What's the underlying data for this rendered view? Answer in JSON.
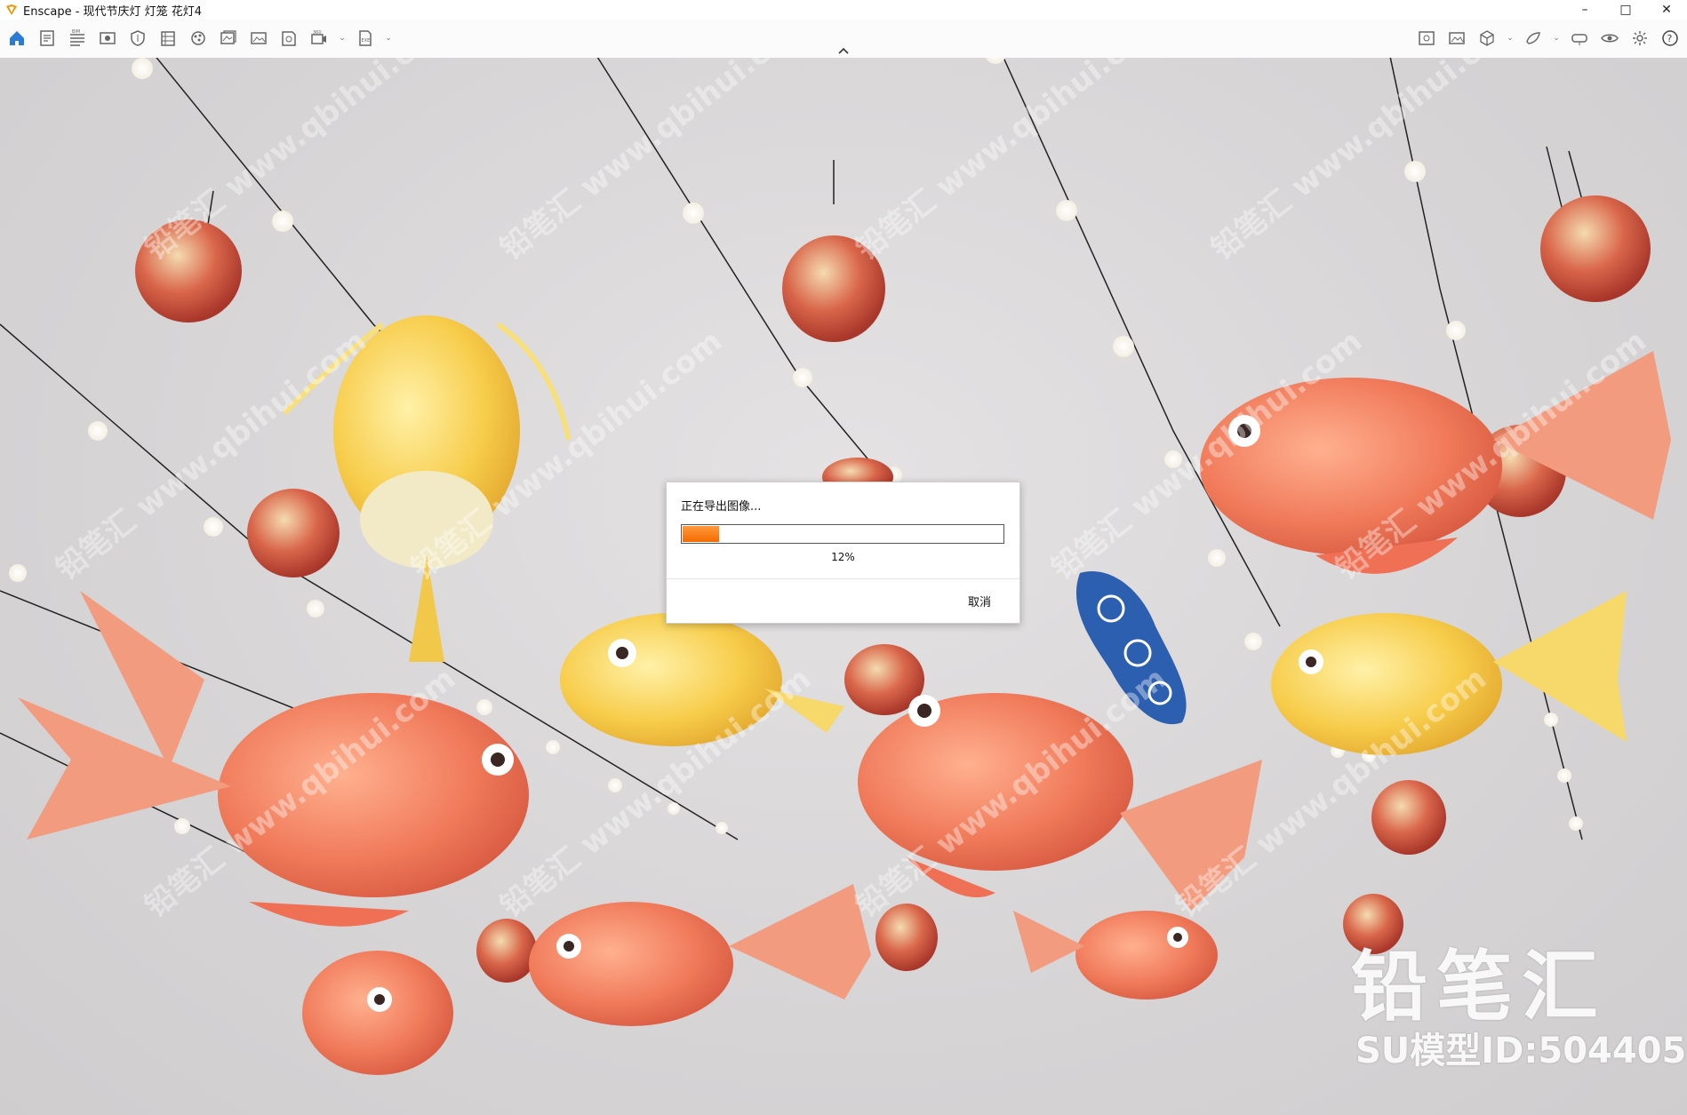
{
  "window": {
    "title": "Enscape - 现代节庆灯 灯笼 花灯4",
    "controls": {
      "minimize": "–",
      "maximize": "□",
      "close": "✕"
    }
  },
  "toolbar": {
    "left_icons": [
      "home-icon",
      "document-icon",
      "bim-list-icon",
      "eye-view-icon",
      "safe-frame-icon",
      "building-icon",
      "material-sphere-icon",
      "batch-render-icon",
      "screenshot-icon",
      "panorama-icon",
      "video-icon",
      "export-icon"
    ],
    "right_icons": [
      "asset-library-icon",
      "image-icon",
      "cube-icon",
      "sun-icon",
      "vr-headset-icon",
      "visibility-icon",
      "settings-icon",
      "help-icon"
    ],
    "help_label": "?",
    "collapse_icon": "chevron-up-icon"
  },
  "dialog": {
    "title": "正在导出图像...",
    "progress_percent": 12,
    "progress_label": "12%",
    "cancel_label": "取消",
    "accent_color": "#f46a00"
  },
  "watermark": {
    "brand": "铅笔汇",
    "model_id": "SU模型ID:504405",
    "tile_text": "铅笔汇 www.qbihui.com"
  }
}
